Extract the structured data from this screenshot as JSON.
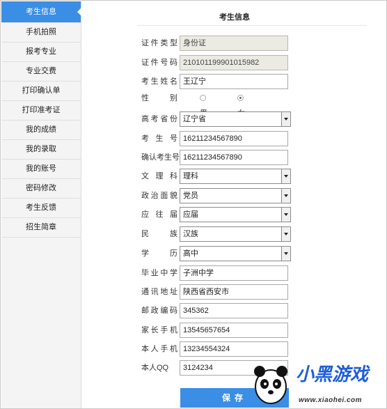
{
  "sidebar": {
    "items": [
      {
        "label": "考生信息",
        "active": true
      },
      {
        "label": "手机拍照"
      },
      {
        "label": "报考专业"
      },
      {
        "label": "专业交费"
      },
      {
        "label": "打印确认单"
      },
      {
        "label": "打印准考证"
      },
      {
        "label": "我的成绩"
      },
      {
        "label": "我的录取"
      },
      {
        "label": "我的账号"
      },
      {
        "label": "密码修改"
      },
      {
        "label": "考生反馈"
      },
      {
        "label": "招生简章"
      }
    ]
  },
  "page": {
    "title": "考生信息"
  },
  "form": {
    "id_type": {
      "label": "证件类型",
      "value": "身份证"
    },
    "id_number": {
      "label": "证件号码",
      "value": "210101199901015982"
    },
    "name": {
      "label": "考生姓名",
      "value": "王辽宁"
    },
    "gender": {
      "label": "性　别",
      "options": [
        "男",
        "女"
      ],
      "selected": "女"
    },
    "province": {
      "label": "高考省份",
      "value": "辽宁省"
    },
    "exam_no": {
      "label": "考 生 号",
      "value": "16211234567890"
    },
    "exam_no_confirm": {
      "label": "确认考生号",
      "value": "16211234567890"
    },
    "track": {
      "label": "文 理 科",
      "value": "理科"
    },
    "political": {
      "label": "政治面貌",
      "value": "党员"
    },
    "graduate_type": {
      "label": "应 往 届",
      "value": "应届"
    },
    "ethnicity": {
      "label": "民　族",
      "value": "汉族"
    },
    "education": {
      "label": "学　历",
      "value": "高中"
    },
    "school": {
      "label": "毕业中学",
      "value": "子洲中学"
    },
    "address": {
      "label": "通讯地址",
      "value": "陕西省西安市"
    },
    "postcode": {
      "label": "邮政编码",
      "value": "345362"
    },
    "parent_phone": {
      "label": "家长手机",
      "value": "13545657654"
    },
    "phone": {
      "label": "本人手机",
      "value": "13234554324"
    },
    "qq": {
      "label": "本人QQ",
      "value": "3124234"
    }
  },
  "save_label": "保存",
  "watermark": {
    "title": "小黑游戏",
    "url": "www.xiaohei.com"
  },
  "colors": {
    "accent": "#3a8ee6",
    "logo": "#1f5fd6"
  }
}
